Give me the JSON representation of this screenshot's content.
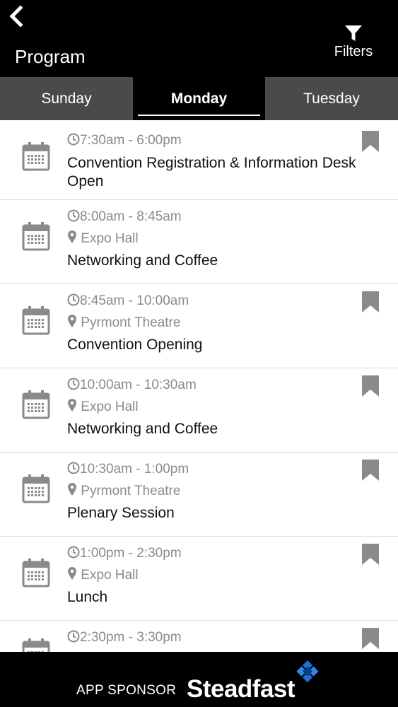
{
  "header": {
    "title": "Program",
    "filters_label": "Filters"
  },
  "tabs": [
    {
      "label": "Sunday",
      "selected": false
    },
    {
      "label": "Monday",
      "selected": true
    },
    {
      "label": "Tuesday",
      "selected": false
    }
  ],
  "events": [
    {
      "time": "7:30am - 6:00pm",
      "location": "",
      "title": "Convention Registration & Information Desk Open",
      "bookmark": true
    },
    {
      "time": "8:00am - 8:45am",
      "location": "Expo Hall",
      "title": "Networking and Coffee",
      "bookmark": false
    },
    {
      "time": "8:45am - 10:00am",
      "location": "Pyrmont Theatre",
      "title": "Convention Opening",
      "bookmark": true
    },
    {
      "time": "10:00am - 10:30am",
      "location": "Expo Hall",
      "title": "Networking and Coffee",
      "bookmark": true
    },
    {
      "time": "10:30am - 1:00pm",
      "location": "Pyrmont Theatre",
      "title": "Plenary Session",
      "bookmark": true
    },
    {
      "time": "1:00pm - 2:30pm",
      "location": "Expo Hall",
      "title": "Lunch",
      "bookmark": true
    },
    {
      "time": "2:30pm - 3:30pm",
      "location": "",
      "title": "",
      "bookmark": true
    }
  ],
  "sponsor": {
    "label": "APP SPONSOR",
    "name": "Steadfast"
  },
  "colors": {
    "header_bg": "#000000",
    "tab_bg": "#4a4a4a",
    "icon_gray": "#8a8a8a",
    "sponsor_mark": "#1e6fd9"
  }
}
